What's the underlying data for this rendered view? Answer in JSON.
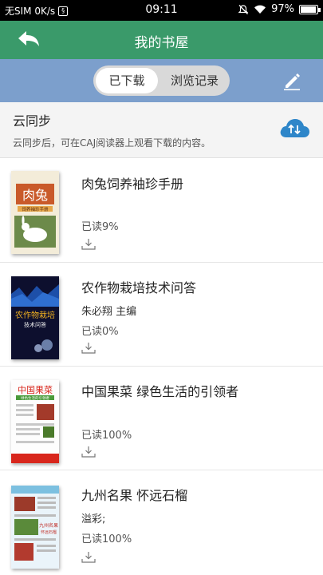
{
  "status": {
    "carrier": "无SIM 0K/s",
    "time": "09:11",
    "battery_text": "97%",
    "battery_level": 0.97,
    "icons": [
      "sim-icon",
      "mute-icon",
      "wifi-icon",
      "battery-icon"
    ]
  },
  "header": {
    "title": "我的书屋",
    "back_icon": "back-arrow-icon"
  },
  "tabs": {
    "active": "已下载",
    "other": "浏览记录",
    "edit_icon": "pencil-icon"
  },
  "sync": {
    "title": "云同步",
    "description": "云同步后，可在CAJ阅读器上观看下载的内容。",
    "icon": "cloud-sync-icon"
  },
  "books": [
    {
      "title": "肉兔饲养袖珍手册",
      "author": "",
      "progress": "已读9%",
      "cover_text": "肉兔",
      "cover_sub": "饲养袖珍手册"
    },
    {
      "title": "农作物栽培技术问答",
      "author": "朱必翔 主编",
      "progress": "已读0%",
      "cover_text": "农作物栽培",
      "cover_sub": "技术问答"
    },
    {
      "title": "中国果菜  绿色生活的引领者",
      "author": "",
      "progress": "已读100%",
      "cover_text": "中国果菜",
      "cover_sub": "绿色生活的引领者"
    },
    {
      "title": "九州名果  怀远石榴",
      "author": "溢彩;",
      "progress": "已读100%",
      "cover_text": "九州名果",
      "cover_sub": "怀远石榴"
    }
  ],
  "colors": {
    "header": "#3a9a6a",
    "tab_strip": "#7c9fcc",
    "cloud": "#2e86c9"
  }
}
